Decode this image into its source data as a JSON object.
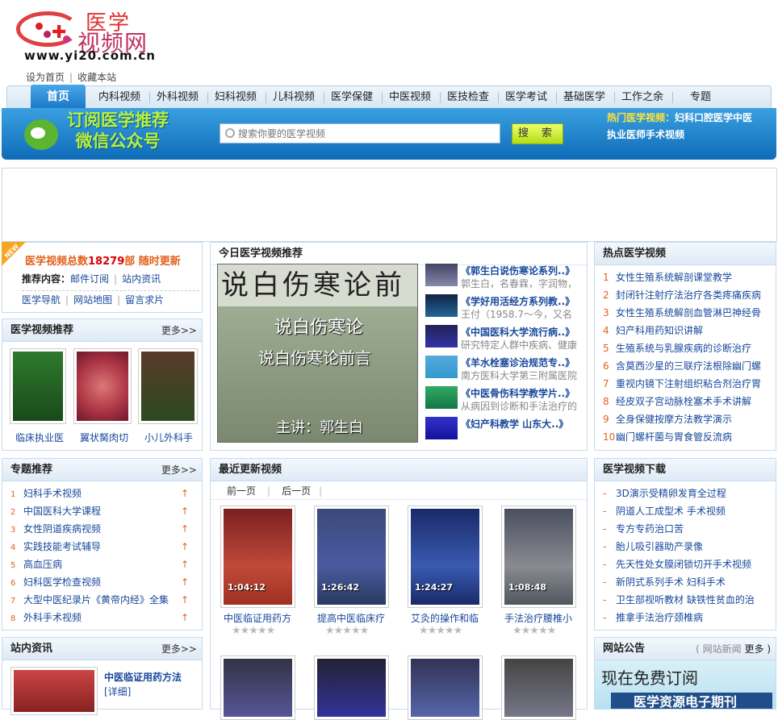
{
  "logo": {
    "title1": "医学",
    "title2": "视频网",
    "url": "www.yi20.com.cn"
  },
  "toplinks": {
    "home": "设为首页",
    "fav": "收藏本站"
  },
  "nav": [
    "首页",
    "内科视频",
    "外科视频",
    "妇科视频",
    "儿科视频",
    "医学保健",
    "中医视频",
    "医技检查",
    "医学考试",
    "基础医学",
    "工作之余",
    "专题"
  ],
  "banner": {
    "line1": "订阅医学推荐",
    "line2": "微信公众号",
    "search_placeholder": "搜索你要的医学视频",
    "search_button": "搜 索",
    "hot_label": "热门医学视频：",
    "hot1": "妇科口腔医学中医",
    "hot2": "执业医师手术视频"
  },
  "stats": {
    "badge": "NEW",
    "prefix": "医学视频总数",
    "count": "18279",
    "unit": "部",
    "suffix": "随时更新",
    "rec_label": "推荐内容：",
    "mail": "邮件订阅",
    "news": "站内资讯",
    "nav": "医学导航",
    "sitemap": "网站地图",
    "message": "留言求片"
  },
  "recommend": {
    "title": "医学视频推荐",
    "more": "更多>>",
    "items": [
      "临床执业医",
      "翼状胬肉切",
      "小儿外科手"
    ]
  },
  "special": {
    "title": "专题推荐",
    "more": "更多>>",
    "items": [
      "妇科手术视频",
      "中国医科大学课程",
      "女性阴道疾病视频",
      "实践技能考试辅导",
      "高血压病",
      "妇科医学检查视频",
      "大型中医纪录片《黄帝内经》全集",
      "外科手术视频"
    ]
  },
  "sitenews": {
    "title": "站内资讯",
    "more": "更多>>",
    "item_title": "中医临证用药方法",
    "detail": "[详细]"
  },
  "today": {
    "title": "今日医学视频推荐",
    "video_caption_line1": "说白伤寒论",
    "video_caption_line2": "说白伤寒论前言",
    "video_caption_line3": "主讲：郭生白",
    "video_bg_text": "说白伤寒论前",
    "items": [
      {
        "t": "《郭生白说伤寒论系列..》",
        "d": "郭生白，名春霖，字润物，"
      },
      {
        "t": "《学好用活经方系列教..》",
        "d": "王付（1958.7～今，又名"
      },
      {
        "t": "《中国医科大学流行病..》",
        "d": "研究特定人群中疾病、健康"
      },
      {
        "t": "《羊水栓塞诊治规范专..》",
        "d": "南方医科大学第三附属医院"
      },
      {
        "t": "《中医骨伤科学教学片..》",
        "d": "从病因到诊断和手法治疗的"
      },
      {
        "t": "《妇产科教学 山东大..》",
        "d": ""
      }
    ]
  },
  "latest": {
    "title": "最近更新视频",
    "prev": "前一页",
    "next": "后一页",
    "items": [
      {
        "t": "中医临证用药方",
        "dur": "1:04:12"
      },
      {
        "t": "提高中医临床疗",
        "dur": "1:26:42"
      },
      {
        "t": "艾灸的操作和临",
        "dur": "1:24:27"
      },
      {
        "t": "手法治疗腰椎小",
        "dur": "1:08:48"
      }
    ]
  },
  "hotvideos": {
    "title": "热点医学视频",
    "items": [
      "女性生殖系统解剖课堂教学",
      "封闭针注射疗法治疗各类疼痛疾病",
      "女性生殖系统解剖血管淋巴神经骨",
      "妇产科用药知识讲解",
      "生殖系统与乳腺疾病的诊断治疗",
      "含莫西沙星的三联疗法根除幽门螺",
      "重视内镜下注射组织粘合剂治疗胃",
      "经皮双子宫动脉栓塞术手术讲解",
      "全身保健按摩方法教学演示",
      "幽门螺杆菌与胃食管反流病"
    ]
  },
  "download": {
    "title": "医学视频下载",
    "items": [
      "3D演示受精卵发育全过程",
      "阴道人工成型术 手术视频",
      "专方专药治口苦",
      "胎儿吸引器助产录像",
      "先天性处女膜闭锁切开手术视频",
      "新阴式系列手术 妇科手术",
      "卫生部视听教材 缺铁性贫血的治",
      "推拿手法治疗颈椎病"
    ]
  },
  "notice": {
    "title": "网站公告",
    "sub": "( 网站新闻",
    "more": "更多 )",
    "banner_text": "现在免费订阅",
    "banner_text2": "医学资源电子期刊"
  },
  "colors": {
    "nav_active": "#1b78c6",
    "link": "#17489b",
    "orange": "#e2601c",
    "green_text": "#b9f13a"
  }
}
